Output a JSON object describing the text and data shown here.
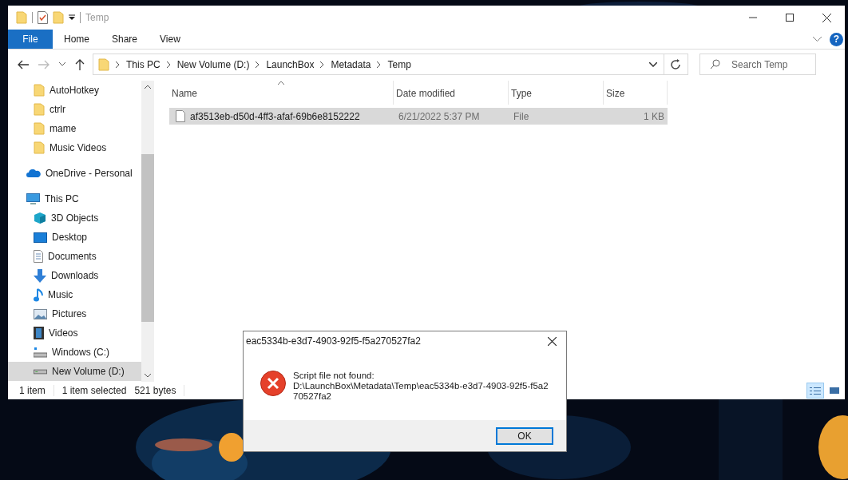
{
  "window": {
    "title": "Temp"
  },
  "ribbon": {
    "tabs": [
      {
        "label": "File",
        "kind": "file",
        "selected": false
      },
      {
        "label": "Home",
        "kind": "tab",
        "selected": false
      },
      {
        "label": "Share",
        "kind": "tab",
        "selected": false
      },
      {
        "label": "View",
        "kind": "tab",
        "selected": false
      }
    ],
    "help": "?"
  },
  "address_bar": {
    "breadcrumbs": [
      "This PC",
      "New Volume (D:)",
      "LaunchBox",
      "Metadata",
      "Temp"
    ]
  },
  "search": {
    "placeholder": "Search Temp"
  },
  "nav_pane": {
    "pinned": [
      {
        "label": "AutoHotkey",
        "selected": false
      },
      {
        "label": "ctrlr",
        "selected": false
      },
      {
        "label": "mame",
        "selected": false
      },
      {
        "label": "Music Videos",
        "selected": false
      }
    ],
    "locations": [
      {
        "label": "OneDrive - Personal",
        "kind": "onedrive",
        "selected": false
      },
      {
        "label": "This PC",
        "kind": "pc",
        "selected": false,
        "children": [
          {
            "label": "3D Objects",
            "kind": "objects3d",
            "selected": false
          },
          {
            "label": "Desktop",
            "kind": "desktop",
            "selected": false
          },
          {
            "label": "Documents",
            "kind": "documents",
            "selected": false
          },
          {
            "label": "Downloads",
            "kind": "downloads",
            "selected": false
          },
          {
            "label": "Music",
            "kind": "music",
            "selected": false
          },
          {
            "label": "Pictures",
            "kind": "pictures",
            "selected": false
          },
          {
            "label": "Videos",
            "kind": "videos",
            "selected": false
          },
          {
            "label": "Windows (C:)",
            "kind": "drive-c",
            "selected": false
          },
          {
            "label": "New Volume (D:)",
            "kind": "drive",
            "selected": true
          }
        ]
      }
    ]
  },
  "file_list": {
    "columns": [
      {
        "label": "Name",
        "sorted": true
      },
      {
        "label": "Date modified",
        "sorted": false
      },
      {
        "label": "Type",
        "sorted": false
      },
      {
        "label": "Size",
        "sorted": false
      }
    ],
    "rows": [
      {
        "name": "af3513eb-d50d-4ff3-afaf-69b6e8152222",
        "date_modified": "6/21/2022 5:37 PM",
        "type": "File",
        "size": "1 KB",
        "selected": true
      }
    ]
  },
  "status_bar": {
    "item_count": "1 item",
    "selection": "1 item selected",
    "size": "521 bytes",
    "views": [
      {
        "kind": "details",
        "selected": true
      },
      {
        "kind": "large-icons",
        "selected": false
      }
    ]
  },
  "dialog": {
    "title": "eac5334b-e3d7-4903-92f5-f5a270527fa2",
    "message_lines": [
      "Script file not found:",
      "D:\\LaunchBox\\Metadata\\Temp\\eac5334b-e3d7-4903-92f5-f5a2",
      "70527fa2"
    ],
    "buttons": [
      {
        "label": "OK",
        "default": true
      }
    ]
  }
}
